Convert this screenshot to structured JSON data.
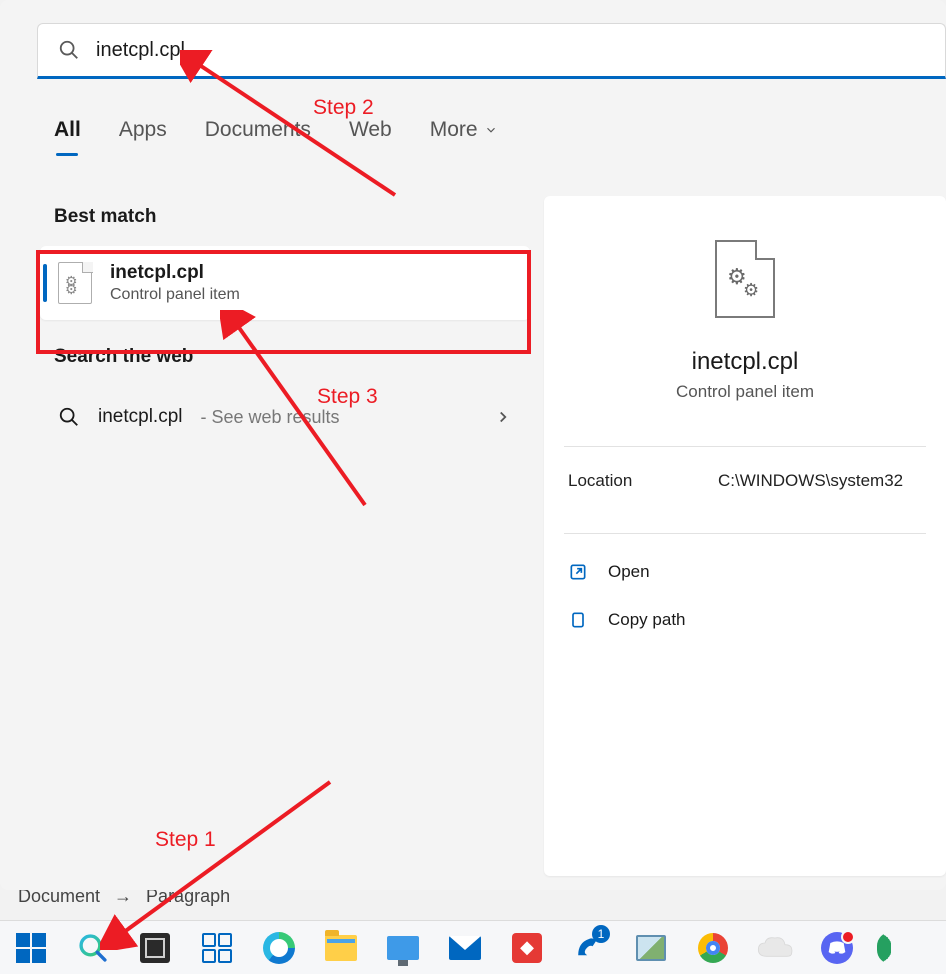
{
  "search": {
    "query": "inetcpl.cpl"
  },
  "tabs": {
    "all": "All",
    "apps": "Apps",
    "documents": "Documents",
    "web": "Web",
    "more": "More"
  },
  "sections": {
    "best_match": "Best match",
    "search_web": "Search the web"
  },
  "best_match": {
    "title": "inetcpl.cpl",
    "subtitle": "Control panel item"
  },
  "web_result": {
    "query": "inetcpl.cpl",
    "suffix": " - See web results"
  },
  "preview": {
    "title": "inetcpl.cpl",
    "subtitle": "Control panel item",
    "location_label": "Location",
    "location_value": "C:\\WINDOWS\\system32",
    "open": "Open",
    "copy_path": "Copy path"
  },
  "annotations": {
    "step1": "Step 1",
    "step2": "Step 2",
    "step3": "Step 3"
  },
  "breadcrumb": {
    "a": "Document",
    "b": "Paragraph"
  },
  "taskbar": {
    "badge1": "1"
  }
}
